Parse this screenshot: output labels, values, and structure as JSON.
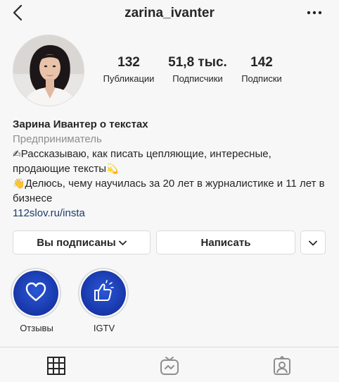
{
  "header": {
    "username": "zarina_ivanter",
    "back_icon": "chevron-left-icon",
    "more_icon": "more-horizontal-icon"
  },
  "profile": {
    "avatar": "avatar-photo",
    "stats": [
      {
        "number": "132",
        "label": "Публикации"
      },
      {
        "number": "51,8 тыс.",
        "label": "Подписчики"
      },
      {
        "number": "142",
        "label": "Подписки"
      }
    ]
  },
  "bio": {
    "name": "Зарина Ивантер о текстах",
    "category": "Предприниматель",
    "line1": "Рассказываю, как писать цепляющие, интересные, продающие тексты",
    "line2": "Делюсь, чему научилась за 20 лет в журналистике и 11 лет в бизнесе",
    "link": "112slov.ru/insta",
    "emoji1": "✍",
    "emoji2": "💫",
    "emoji3": "👋"
  },
  "buttons": {
    "follow_label": "Вы подписаны",
    "message_label": "Написать"
  },
  "highlights": [
    {
      "label": "Отзывы",
      "icon": "heart-icon"
    },
    {
      "label": "IGTV",
      "icon": "thumbs-up-icon"
    }
  ],
  "tabs": [
    "grid-icon",
    "igtv-icon",
    "tagged-icon"
  ],
  "colors": {
    "highlight_blue": "#1736a8",
    "link": "#1b3a6b",
    "muted": "#8e8e8e"
  }
}
